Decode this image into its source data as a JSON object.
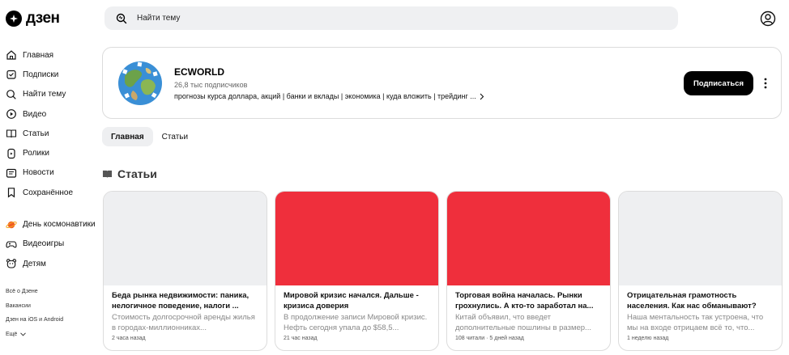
{
  "app": {
    "logo_text": "дзен"
  },
  "search": {
    "placeholder": "Найти тему"
  },
  "nav": {
    "items": [
      {
        "label": "Главная",
        "icon": "home-icon"
      },
      {
        "label": "Подписки",
        "icon": "subscriptions-icon"
      },
      {
        "label": "Найти тему",
        "icon": "search-icon"
      },
      {
        "label": "Видео",
        "icon": "video-icon"
      },
      {
        "label": "Статьи",
        "icon": "articles-icon"
      },
      {
        "label": "Ролики",
        "icon": "clips-icon"
      },
      {
        "label": "Новости",
        "icon": "news-icon"
      },
      {
        "label": "Сохранённое",
        "icon": "bookmark-icon"
      }
    ],
    "special": [
      {
        "label": "День космонавтики",
        "icon": "planet-icon"
      },
      {
        "label": "Видеоигры",
        "icon": "gamepad-icon"
      },
      {
        "label": "Детям",
        "icon": "kids-icon"
      }
    ],
    "footer": [
      "Всё о Дзене",
      "Вакансии",
      "Дзен на iOS и Android",
      "Ещё"
    ]
  },
  "channel": {
    "name": "ECWORLD",
    "subscribers": "26,8 тыс подписчиков",
    "description": "прогнозы курса доллара, акций | банки и вклады | экономика | куда вложить | трейдинг ...",
    "subscribe_label": "Подписаться"
  },
  "tabs": [
    {
      "label": "Главная",
      "active": true
    },
    {
      "label": "Статьи",
      "active": false
    }
  ],
  "section": {
    "title": "Статьи"
  },
  "articles": [
    {
      "title": "Беда рынка недвижимости: паника, нелогичное поведение, налоги ...",
      "snippet": "Стоимость долгосрочной аренды жилья в городах-миллионниках...",
      "meta": "2 часа назад",
      "image_color": "#eeeff1"
    },
    {
      "title": "Мировой кризис начался. Дальше - кризиса доверия",
      "snippet": "В продолжение записи Мировой кризис. Нефть сегодня упала до $58,5...",
      "meta": "21 час назад",
      "image_color": "#ef2f3c"
    },
    {
      "title": "Торговая война началась. Рынки грохнулись. А кто-то заработал на...",
      "snippet": "Китай объявил, что введет дополнительные пошлины в размер...",
      "meta": "108 читали · 5 дней назад",
      "image_color": "#ef2f3c"
    },
    {
      "title": "Отрицательная грамотность населения. Как нас обманывают?",
      "snippet": "Наша ментальность так устроена, что мы на входе отрицаем всё то, что...",
      "meta": "1 неделю назад",
      "image_color": "#eeeff1"
    }
  ]
}
